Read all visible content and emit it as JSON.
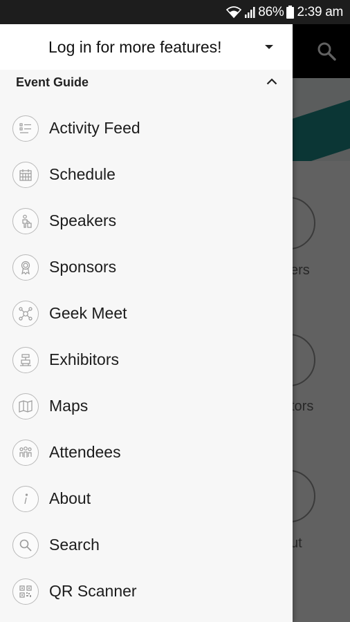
{
  "status_bar": {
    "battery_percent": "86%",
    "time": "2:39 am"
  },
  "drawer": {
    "login_prompt": "Log in for more features!",
    "section_title": "Event Guide",
    "items": [
      {
        "label": "Activity Feed",
        "icon": "activity-feed-icon"
      },
      {
        "label": "Schedule",
        "icon": "calendar-icon"
      },
      {
        "label": "Speakers",
        "icon": "speaker-icon"
      },
      {
        "label": "Sponsors",
        "icon": "award-icon"
      },
      {
        "label": "Geek Meet",
        "icon": "network-icon"
      },
      {
        "label": "Exhibitors",
        "icon": "booth-icon"
      },
      {
        "label": "Maps",
        "icon": "map-icon"
      },
      {
        "label": "Attendees",
        "icon": "people-icon"
      },
      {
        "label": "About",
        "icon": "info-icon"
      },
      {
        "label": "Search",
        "icon": "search-icon"
      },
      {
        "label": "QR Scanner",
        "icon": "qr-code-icon"
      }
    ]
  },
  "background": {
    "labels": [
      "ers",
      "tors",
      "ut"
    ]
  },
  "colors": {
    "status_bar": "#1d1d1d",
    "drawer_bg": "#f7f7f7",
    "app_header": "#000000",
    "banner_accent": "#1f8f8c"
  }
}
